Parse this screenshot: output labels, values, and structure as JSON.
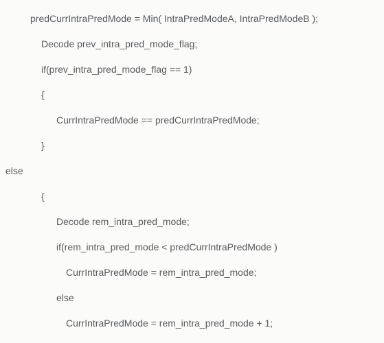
{
  "code": {
    "l1": "predCurrIntraPredMode = Min( IntraPredModeA, IntraPredModeB );",
    "l2": "Decode prev_intra_pred_mode_flag;",
    "l3": "if(prev_intra_pred_mode_flag == 1)",
    "l4": "{",
    "l5": "CurrIntraPredMode == predCurrIntraPredMode;",
    "l6": "}",
    "l7": "else",
    "l8": "{",
    "l9": "Decode rem_intra_pred_mode;",
    "l10": "if(rem_intra_pred_mode < predCurrIntraPredMode )",
    "l11": "CurrIntraPredMode = rem_intra_pred_mode;",
    "l12": "else",
    "l13": "CurrIntraPredMode = rem_intra_pred_mode + 1;"
  }
}
